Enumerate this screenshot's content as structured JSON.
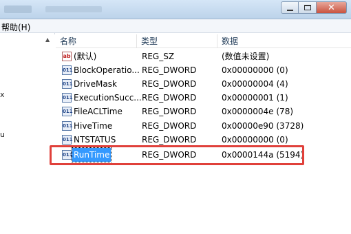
{
  "window": {
    "buttons": {
      "minimize": "minimize",
      "maximize": "maximize",
      "close": "close"
    }
  },
  "menu": {
    "help": "帮助(H)"
  },
  "tree_fragments": [
    "x",
    "u"
  ],
  "list": {
    "headers": {
      "name": "名称",
      "type": "类型",
      "data": "数据"
    },
    "rows": [
      {
        "icon": "string-value-icon",
        "icon_text": "ab",
        "name": "(默认)",
        "type": "REG_SZ",
        "data": "(数值未设置)"
      },
      {
        "icon": "binary-value-icon",
        "icon_text": "011",
        "name": "BlockOperatio...",
        "type": "REG_DWORD",
        "data": "0x00000000 (0)"
      },
      {
        "icon": "binary-value-icon",
        "icon_text": "011",
        "name": "DriveMask",
        "type": "REG_DWORD",
        "data": "0x00000004 (4)"
      },
      {
        "icon": "binary-value-icon",
        "icon_text": "011",
        "name": "ExecutionSucc...",
        "type": "REG_DWORD",
        "data": "0x00000001 (1)"
      },
      {
        "icon": "binary-value-icon",
        "icon_text": "011",
        "name": "FileACLTime",
        "type": "REG_DWORD",
        "data": "0x0000004e (78)"
      },
      {
        "icon": "binary-value-icon",
        "icon_text": "011",
        "name": "HiveTime",
        "type": "REG_DWORD",
        "data": "0x00000e90 (3728)"
      },
      {
        "icon": "binary-value-icon",
        "icon_text": "011",
        "name": "NTSTATUS",
        "type": "REG_DWORD",
        "data": "0x00000000 (0)"
      },
      {
        "icon": "binary-value-icon",
        "icon_text": "011",
        "name": "RunTime",
        "type": "REG_DWORD",
        "data": "0x0000144a (5194)"
      }
    ]
  },
  "colors": {
    "selection": "#3399ff",
    "highlight_border": "#e0403a"
  }
}
